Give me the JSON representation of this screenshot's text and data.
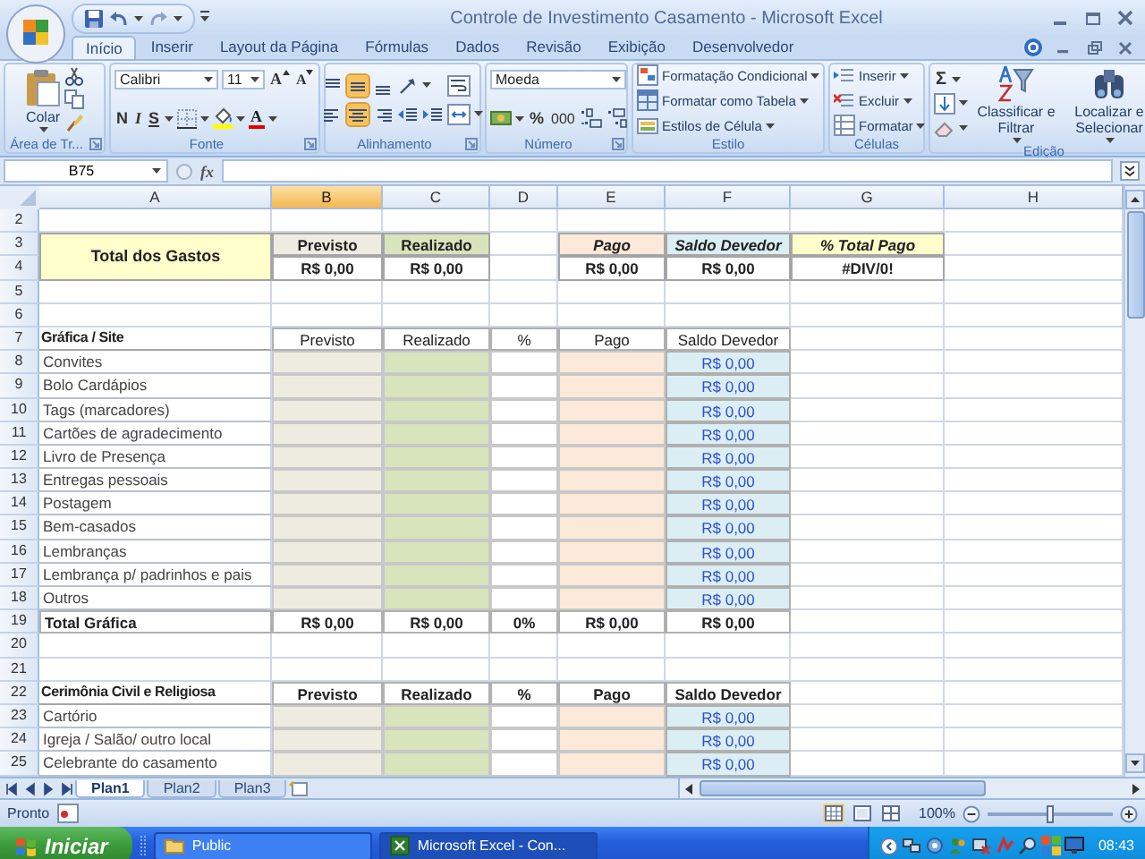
{
  "window": {
    "title": "Controle de Investimento Casamento - Microsoft Excel"
  },
  "ribbon_tabs": [
    {
      "label": "Início",
      "selected": true
    },
    {
      "label": "Inserir",
      "selected": false
    },
    {
      "label": "Layout da Página",
      "selected": false
    },
    {
      "label": "Fórmulas",
      "selected": false
    },
    {
      "label": "Dados",
      "selected": false
    },
    {
      "label": "Revisão",
      "selected": false
    },
    {
      "label": "Exibição",
      "selected": false
    },
    {
      "label": "Desenvolvedor",
      "selected": false
    }
  ],
  "ribbon": {
    "groups": [
      {
        "kind": "clipboard",
        "label": "Área de Tr...",
        "paste_label": "Colar"
      },
      {
        "kind": "font",
        "label": "Fonte",
        "font": "Calibri",
        "size": "11",
        "grow": "A",
        "shrink": "A",
        "styles": [
          {
            "kind": "bold",
            "label": "N"
          },
          {
            "kind": "italic",
            "label": "I"
          },
          {
            "kind": "underline",
            "label": "S"
          }
        ],
        "color_label": "A"
      },
      {
        "kind": "alignment",
        "label": "Alinhamento",
        "buttons": [
          {
            "kind": "align-top",
            "selected": false
          },
          {
            "kind": "align-middle",
            "selected": true
          },
          {
            "kind": "align-bottom",
            "selected": false
          },
          {
            "kind": "align-left",
            "selected": false
          },
          {
            "kind": "align-center",
            "selected": true
          },
          {
            "kind": "align-right",
            "selected": false
          }
        ]
      },
      {
        "kind": "number",
        "label": "Número",
        "format": "Moeda",
        "percent": "%",
        "thousands": "000"
      },
      {
        "kind": "styles",
        "label": "Estilo",
        "items": [
          "Formatação Condicional",
          "Formatar como Tabela",
          "Estilos de Célula"
        ]
      },
      {
        "kind": "cells",
        "label": "Células",
        "items": [
          "Inserir",
          "Excluir",
          "Formatar"
        ]
      },
      {
        "kind": "editing",
        "label": "Edição",
        "sum": "Σ",
        "items": [
          "Classificar e Filtrar",
          "Localizar e Selecionar"
        ]
      }
    ]
  },
  "formula_bar": {
    "name_box": "B75",
    "function_label": "fx"
  },
  "sheet": {
    "columns": [
      {
        "label": "A",
        "selected": false
      },
      {
        "label": "B",
        "selected": true
      },
      {
        "label": "C",
        "selected": false
      },
      {
        "label": "D",
        "selected": false
      },
      {
        "label": "E",
        "selected": false
      },
      {
        "label": "F",
        "selected": false
      },
      {
        "label": "G",
        "selected": false
      },
      {
        "label": "H",
        "selected": false
      }
    ],
    "rows": [
      {
        "n": "2"
      },
      {
        "n": "3",
        "cells": [
          {
            "kind": "total-title",
            "text": "Total dos Gastos",
            "merged_down": true
          },
          {
            "kind": "head-previsto",
            "text": "Previsto"
          },
          {
            "kind": "head-realizado",
            "text": "Realizado"
          },
          {
            "kind": "blank"
          },
          {
            "kind": "head-pago",
            "text": "Pago"
          },
          {
            "kind": "head-saldo",
            "text": "Saldo Devedor"
          },
          {
            "kind": "head-pct",
            "text": "% Total Pago"
          }
        ]
      },
      {
        "n": "4",
        "cells": [
          {
            "kind": "value",
            "text": "R$ 0,00"
          },
          {
            "kind": "value",
            "text": "R$ 0,00"
          },
          {
            "kind": "blank"
          },
          {
            "kind": "value",
            "text": "R$ 0,00"
          },
          {
            "kind": "value",
            "text": "R$ 0,00"
          },
          {
            "kind": "value",
            "text": "#DIV/0!"
          }
        ]
      },
      {
        "n": "5"
      },
      {
        "n": "6"
      },
      {
        "n": "7",
        "cells": [
          {
            "kind": "section",
            "text": "Gráfica / Site"
          },
          {
            "kind": "header",
            "text": "Previsto"
          },
          {
            "kind": "header",
            "text": "Realizado"
          },
          {
            "kind": "header",
            "text": "%"
          },
          {
            "kind": "header",
            "text": "Pago"
          },
          {
            "kind": "header",
            "text": "Saldo Devedor"
          }
        ]
      },
      {
        "n": "8",
        "cells": [
          {
            "kind": "item",
            "text": "Convites"
          },
          {
            "kind": "previsto"
          },
          {
            "kind": "realizado"
          },
          {
            "kind": "pct"
          },
          {
            "kind": "pago"
          },
          {
            "kind": "saldo",
            "text": "R$ 0,00"
          }
        ]
      },
      {
        "n": "9",
        "cells": [
          {
            "kind": "item",
            "text": "Bolo Cardápios"
          },
          {
            "kind": "previsto"
          },
          {
            "kind": "realizado"
          },
          {
            "kind": "pct"
          },
          {
            "kind": "pago"
          },
          {
            "kind": "saldo",
            "text": "R$ 0,00"
          }
        ]
      },
      {
        "n": "10",
        "cells": [
          {
            "kind": "item",
            "text": "Tags (marcadores)"
          },
          {
            "kind": "previsto"
          },
          {
            "kind": "realizado"
          },
          {
            "kind": "pct"
          },
          {
            "kind": "pago"
          },
          {
            "kind": "saldo",
            "text": "R$ 0,00"
          }
        ]
      },
      {
        "n": "11",
        "cells": [
          {
            "kind": "item",
            "text": "Cartões de agradecimento"
          },
          {
            "kind": "previsto"
          },
          {
            "kind": "realizado"
          },
          {
            "kind": "pct"
          },
          {
            "kind": "pago"
          },
          {
            "kind": "saldo",
            "text": "R$ 0,00"
          }
        ]
      },
      {
        "n": "12",
        "cells": [
          {
            "kind": "item",
            "text": "Livro de Presença"
          },
          {
            "kind": "previsto"
          },
          {
            "kind": "realizado"
          },
          {
            "kind": "pct"
          },
          {
            "kind": "pago"
          },
          {
            "kind": "saldo",
            "text": "R$ 0,00"
          }
        ]
      },
      {
        "n": "13",
        "cells": [
          {
            "kind": "item",
            "text": "Entregas pessoais"
          },
          {
            "kind": "previsto"
          },
          {
            "kind": "realizado"
          },
          {
            "kind": "pct"
          },
          {
            "kind": "pago"
          },
          {
            "kind": "saldo",
            "text": "R$ 0,00"
          }
        ]
      },
      {
        "n": "14",
        "cells": [
          {
            "kind": "item",
            "text": "Postagem"
          },
          {
            "kind": "previsto"
          },
          {
            "kind": "realizado"
          },
          {
            "kind": "pct"
          },
          {
            "kind": "pago"
          },
          {
            "kind": "saldo",
            "text": "R$ 0,00"
          }
        ]
      },
      {
        "n": "15",
        "cells": [
          {
            "kind": "item",
            "text": "Bem-casados"
          },
          {
            "kind": "previsto"
          },
          {
            "kind": "realizado"
          },
          {
            "kind": "pct"
          },
          {
            "kind": "pago"
          },
          {
            "kind": "saldo",
            "text": "R$ 0,00"
          }
        ]
      },
      {
        "n": "16",
        "cells": [
          {
            "kind": "item",
            "text": "Lembranças"
          },
          {
            "kind": "previsto"
          },
          {
            "kind": "realizado"
          },
          {
            "kind": "pct"
          },
          {
            "kind": "pago"
          },
          {
            "kind": "saldo",
            "text": "R$ 0,00"
          }
        ]
      },
      {
        "n": "17",
        "cells": [
          {
            "kind": "item",
            "text": "Lembrança p/ padrinhos e pais"
          },
          {
            "kind": "previsto"
          },
          {
            "kind": "realizado"
          },
          {
            "kind": "pct"
          },
          {
            "kind": "pago"
          },
          {
            "kind": "saldo",
            "text": "R$ 0,00"
          }
        ]
      },
      {
        "n": "18",
        "cells": [
          {
            "kind": "item",
            "text": "Outros"
          },
          {
            "kind": "previsto"
          },
          {
            "kind": "realizado"
          },
          {
            "kind": "pct"
          },
          {
            "kind": "pago"
          },
          {
            "kind": "saldo",
            "text": "R$ 0,00"
          }
        ]
      },
      {
        "n": "19",
        "cells": [
          {
            "kind": "total-label",
            "text": "Total Gráfica"
          },
          {
            "kind": "total",
            "text": "R$ 0,00"
          },
          {
            "kind": "total",
            "text": "R$ 0,00"
          },
          {
            "kind": "total",
            "text": "0%"
          },
          {
            "kind": "total",
            "text": "R$ 0,00"
          },
          {
            "kind": "total",
            "text": "R$ 0,00"
          }
        ]
      },
      {
        "n": "20"
      },
      {
        "n": "21"
      },
      {
        "n": "22",
        "cells": [
          {
            "kind": "section",
            "text": "Cerimônia Civil e Religiosa"
          },
          {
            "kind": "header-bold",
            "text": "Previsto"
          },
          {
            "kind": "header-bold",
            "text": "Realizado"
          },
          {
            "kind": "header-bold",
            "text": "%"
          },
          {
            "kind": "header-bold",
            "text": "Pago"
          },
          {
            "kind": "header-bold",
            "text": "Saldo Devedor"
          }
        ]
      },
      {
        "n": "23",
        "cells": [
          {
            "kind": "item",
            "text": "Cartório"
          },
          {
            "kind": "previsto"
          },
          {
            "kind": "realizado"
          },
          {
            "kind": "pct"
          },
          {
            "kind": "pago"
          },
          {
            "kind": "saldo",
            "text": "R$ 0,00"
          }
        ]
      },
      {
        "n": "24",
        "cells": [
          {
            "kind": "item",
            "text": "Igreja / Salão/ outro local"
          },
          {
            "kind": "previsto"
          },
          {
            "kind": "realizado"
          },
          {
            "kind": "pct"
          },
          {
            "kind": "pago"
          },
          {
            "kind": "saldo",
            "text": "R$ 0,00"
          }
        ]
      },
      {
        "n": "25",
        "cells": [
          {
            "kind": "item",
            "text": "Celebrante do casamento"
          },
          {
            "kind": "previsto"
          },
          {
            "kind": "realizado"
          },
          {
            "kind": "pct"
          },
          {
            "kind": "pago"
          },
          {
            "kind": "saldo",
            "text": "R$ 0,00"
          }
        ]
      }
    ]
  },
  "sheet_tabs": [
    {
      "label": "Plan1",
      "selected": true
    },
    {
      "label": "Plan2",
      "selected": false
    },
    {
      "label": "Plan3",
      "selected": false
    }
  ],
  "status_bar": {
    "status": "Pronto",
    "views": [
      {
        "kind": "normal",
        "selected": true
      },
      {
        "kind": "page-layout",
        "selected": false
      },
      {
        "kind": "page-break",
        "selected": false
      }
    ],
    "zoom": "100%",
    "zoom_slider": {
      "level": 0.5
    }
  },
  "taskbar": {
    "start": "Iniciar",
    "tasks": [
      {
        "kind": "folder",
        "label": "Public",
        "selected": false
      },
      {
        "kind": "excel",
        "label": "Microsoft Excel - Con...",
        "selected": true
      }
    ],
    "clock": "08:43"
  }
}
